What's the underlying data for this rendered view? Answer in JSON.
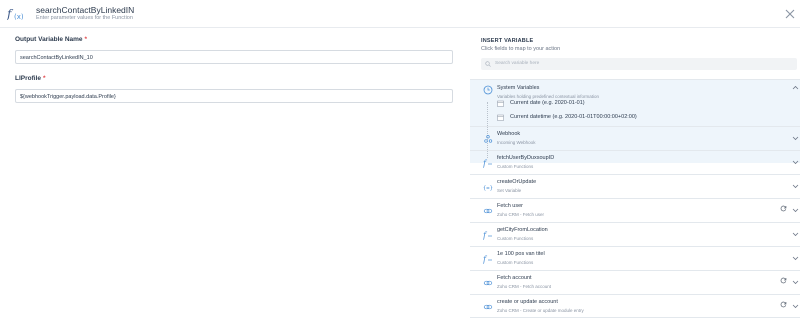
{
  "header": {
    "title": "searchContactByLinkedIN",
    "subtitle": "Enter parameter values for the Function"
  },
  "form": {
    "output_variable": {
      "label": "Output Variable Name",
      "required_mark": "*",
      "value": "searchContactByLinkedIN_10"
    },
    "li_profile": {
      "label": "LIProfile",
      "required_mark": "*",
      "value": "${webhookTrigger.payload.data.Profile}"
    }
  },
  "insert_variable": {
    "title": "INSERT VARIABLE",
    "subtitle": "Click fields to map to your action",
    "search_placeholder": "Search variable here"
  },
  "system_variables": {
    "title": "System Variables",
    "subtitle": "Variables holding predefined contextual information",
    "items": [
      {
        "label": "Current date (e.g. 2020-01-01)",
        "icon": "calendar-icon"
      },
      {
        "label": "Current datetime (e.g. 2020-01-01T00:00:00+02:00)",
        "icon": "calendar-icon"
      }
    ]
  },
  "sections": [
    {
      "title": "Webhook",
      "subtitle": "Incoming Webhook",
      "icon": "webhook-icon",
      "refresh": false
    },
    {
      "title": "fetchUserByDuxsoupID",
      "subtitle": "Custom Functions",
      "icon": "function-icon",
      "refresh": false
    },
    {
      "title": "createOrUpdate",
      "subtitle": "Set Variable",
      "icon": "variable-icon",
      "refresh": false
    },
    {
      "title": "Fetch user",
      "subtitle": "Zoho CRM - Fetch user",
      "icon": "crm-icon",
      "refresh": true
    },
    {
      "title": "getCityFromLocation",
      "subtitle": "Custom Functions",
      "icon": "function-icon",
      "refresh": false
    },
    {
      "title": "1e 100 pos van titel",
      "subtitle": "Custom Functions",
      "icon": "function-icon",
      "refresh": false
    },
    {
      "title": "Fetch account",
      "subtitle": "Zoho CRM - Fetch account",
      "icon": "crm-icon",
      "refresh": true
    },
    {
      "title": "create or update account",
      "subtitle": "Zoho CRM - Create or update module entry",
      "icon": "crm-icon",
      "refresh": true
    }
  ],
  "colors": {
    "accent": "#4a8fd6",
    "required": "#e2474b",
    "panel_highlight": "#eef5fb"
  }
}
